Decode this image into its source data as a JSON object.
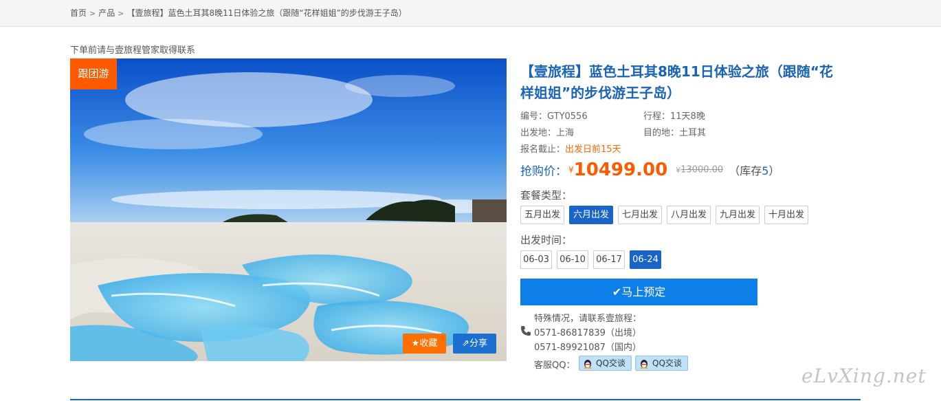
{
  "breadcrumb": {
    "items": [
      "首页",
      "产品",
      "【壹旅程】蓝色土耳其8晚11日体验之旅（跟随“花样姐姐”的步伐游王子岛）"
    ]
  },
  "notice": "下单前请与壹旅程管家取得联系",
  "photo": {
    "tag": "跟团游",
    "favorite_label": "收藏",
    "share_label": "分享"
  },
  "product": {
    "title": "【壹旅程】蓝色土耳其8晚11日体验之旅（跟随“花样姐姐”的步伐游王子岛）",
    "code_label": "编号：",
    "code": "GTY0556",
    "duration_label": "行程：",
    "duration": "11天8晚",
    "departure_label": "出发地：",
    "departure": "上海",
    "destination_label": "目的地：",
    "destination": "土耳其",
    "deadline_label": "报名截止：",
    "deadline": "出发日前15天"
  },
  "price": {
    "label": "抢购价：",
    "currency": "¥",
    "current": "10499.00",
    "original_currency": "¥",
    "original": "13000.00",
    "stock_prefix": "（库存",
    "stock": "5",
    "stock_suffix": "）"
  },
  "package": {
    "label": "套餐类型：",
    "options": [
      "五月出发",
      "六月出发",
      "七月出发",
      "八月出发",
      "九月出发",
      "十月出发"
    ],
    "selected": "六月出发"
  },
  "departure_time": {
    "label": "出发时间：",
    "options": [
      "06-03",
      "06-10",
      "06-17",
      "06-24"
    ],
    "selected": "06-24"
  },
  "book_label": "马上预定",
  "contact": {
    "intro": "特殊情况，请联系壹旅程：",
    "phone1": "0571-86817839（出境）",
    "phone2": "0571-89921087（国内）",
    "qq_label": "客服QQ：",
    "qq_buttons": [
      "QQ交谈",
      "QQ交谈"
    ]
  },
  "watermark": "eLvXing.net",
  "colors": {
    "brand_blue": "#1a64b8",
    "accent_orange": "#ff5a00",
    "book_blue": "#0e7fe8"
  }
}
